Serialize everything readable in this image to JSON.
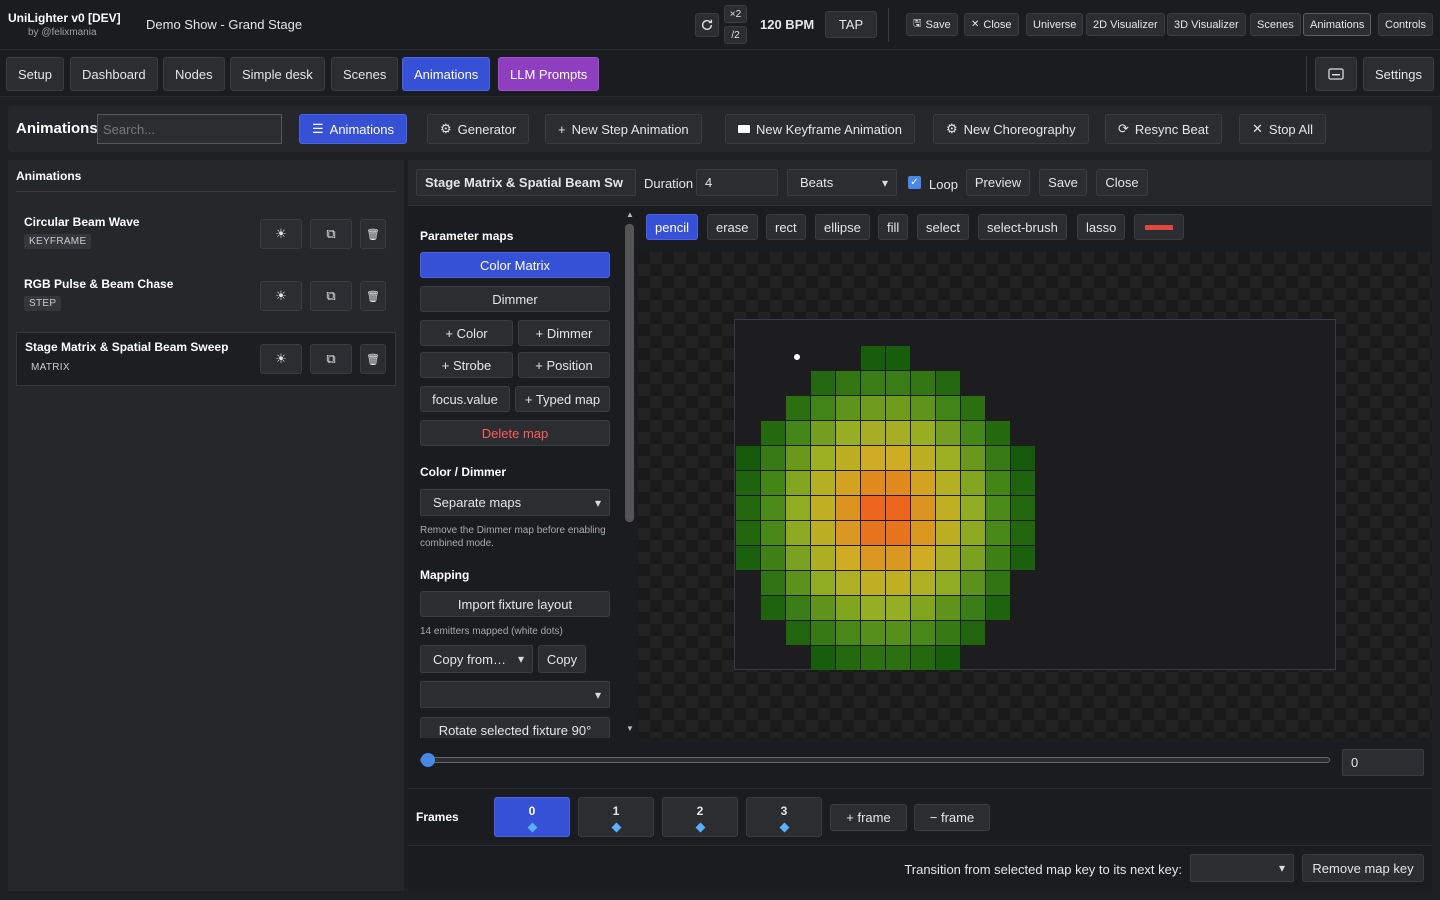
{
  "app": {
    "title": "UniLighter v0 [DEV]",
    "subtitle": "by @felixmania",
    "show": "Demo Show - Grand Stage"
  },
  "tempo": {
    "double": "×2",
    "half": "/2",
    "bpm": "120 BPM",
    "tap": "TAP"
  },
  "topbar": {
    "save": "Save",
    "close": "Close",
    "universe": "Universe",
    "viz2d": "2D Visualizer",
    "viz3d": "3D Visualizer",
    "scenes": "Scenes",
    "animations": "Animations",
    "controls": "Controls"
  },
  "nav": {
    "tabs": [
      "Setup",
      "Dashboard",
      "Nodes",
      "Simple desk",
      "Scenes",
      "Animations",
      "LLM Prompts"
    ],
    "settings": "Settings"
  },
  "toolbar": {
    "title": "Animations",
    "search_placeholder": "Search...",
    "animations": "Animations",
    "generator": "Generator",
    "new_step": "New Step Animation",
    "new_keyframe": "New Keyframe Animation",
    "new_choreo": "New Choreography",
    "resync": "Resync Beat",
    "stop_all": "Stop All"
  },
  "sidebar": {
    "title": "Animations",
    "items": [
      {
        "name": "Circular Beam Wave",
        "type": "KEYFRAME"
      },
      {
        "name": "RGB Pulse & Beam Chase",
        "type": "STEP"
      },
      {
        "name": "Stage Matrix & Spatial Beam Sweep",
        "type": "MATRIX"
      }
    ]
  },
  "editor": {
    "name": "Stage Matrix & Spatial Beam Sw",
    "duration_label": "Duration",
    "duration_value": "4",
    "unit": "Beats",
    "loop_label": "Loop",
    "preview": "Preview",
    "save": "Save",
    "close": "Close"
  },
  "param_maps": {
    "title": "Parameter maps",
    "maps": [
      "Color Matrix",
      "Dimmer"
    ],
    "add_color": "+ Color",
    "add_dimmer": "+ Dimmer",
    "add_strobe": "+ Strobe",
    "add_position": "+ Position",
    "focus": "focus.value",
    "typed_map": "+ Typed map",
    "delete_map": "Delete map",
    "color_dimmer_title": "Color / Dimmer",
    "color_dimmer_mode": "Separate maps",
    "color_dimmer_note": "Remove the Dimmer map before enabling combined mode.",
    "mapping_title": "Mapping",
    "import_layout": "Import fixture layout",
    "emitters_note": "14 emitters mapped (white dots)",
    "copy_from": "Copy from…",
    "copy": "Copy",
    "rotate": "Rotate selected fixture 90°"
  },
  "tools": {
    "items": [
      "pencil",
      "erase",
      "rect",
      "ellipse",
      "fill",
      "select",
      "select-brush",
      "lasso"
    ],
    "active": "pencil",
    "color": "#e0483e"
  },
  "timeline": {
    "value": "0",
    "position": 0
  },
  "frames": {
    "label": "Frames",
    "items": [
      "0",
      "1",
      "2",
      "3"
    ],
    "add": "+ frame",
    "remove": "− frame"
  },
  "transition": {
    "label": "Transition from selected map key to its next key:",
    "remove_key": "Remove map key"
  }
}
